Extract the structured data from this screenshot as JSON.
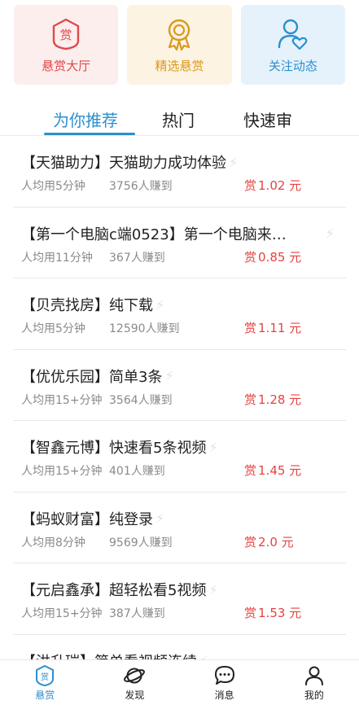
{
  "top_cards": [
    {
      "label": "悬赏大厅",
      "icon": "reward-hall-icon",
      "icon_text": "赏",
      "color": "#e0484a"
    },
    {
      "label": "精选悬赏",
      "icon": "award-badge-icon",
      "color": "#d99a1e"
    },
    {
      "label": "关注动态",
      "icon": "user-heart-icon",
      "color": "#2b90cf"
    }
  ],
  "tabs": [
    {
      "label": "为你推荐",
      "active": true
    },
    {
      "label": "热门",
      "active": false
    },
    {
      "label": "快速审",
      "active": false
    }
  ],
  "tasks": [
    {
      "title": "【天猫助力】天猫助力成功体验",
      "avg_time": "人均用5分钟",
      "earned": "3756人赚到",
      "reward_symbol": "赏",
      "reward": "1.02 元"
    },
    {
      "title": "【第一个电脑c端0523】第一个电脑来…",
      "avg_time": "人均用11分钟",
      "earned": "367人赚到",
      "reward_symbol": "赏",
      "reward": "0.85 元"
    },
    {
      "title": "【贝壳找房】纯下载",
      "avg_time": "人均用5分钟",
      "earned": "12590人赚到",
      "reward_symbol": "赏",
      "reward": "1.11 元"
    },
    {
      "title": "【优优乐园】简单3条",
      "avg_time": "人均用15+分钟",
      "earned": "3564人赚到",
      "reward_symbol": "赏",
      "reward": "1.28 元"
    },
    {
      "title": "【智鑫元博】快速看5条视频",
      "avg_time": "人均用15+分钟",
      "earned": "401人赚到",
      "reward_symbol": "赏",
      "reward": "1.45 元"
    },
    {
      "title": "【蚂蚁财富】纯登录",
      "avg_time": "人均用8分钟",
      "earned": "9569人赚到",
      "reward_symbol": "赏",
      "reward": "2.0 元"
    },
    {
      "title": "【元启鑫承】超轻松看5视频",
      "avg_time": "人均用15+分钟",
      "earned": "387人赚到",
      "reward_symbol": "赏",
      "reward": "1.53 元"
    },
    {
      "title": "【洪升瑞】简单看视频连续",
      "avg_time": "",
      "earned": "",
      "reward_symbol": "",
      "reward": ""
    }
  ],
  "bottom_nav": [
    {
      "label": "悬赏",
      "icon": "reward-icon",
      "icon_text": "赏",
      "active": true
    },
    {
      "label": "发现",
      "icon": "planet-icon",
      "active": false
    },
    {
      "label": "消息",
      "icon": "chat-bubble-icon",
      "active": false
    },
    {
      "label": "我的",
      "icon": "person-icon",
      "active": false
    }
  ],
  "colors": {
    "accent": "#2c8fd0",
    "reward": "#e64340",
    "muted": "#8a8a8a"
  }
}
